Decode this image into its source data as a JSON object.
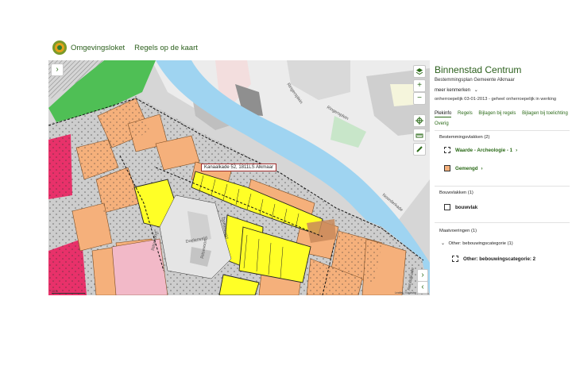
{
  "header": {
    "brand_name": "Omgevingsloket",
    "title": "Regels op de kaart"
  },
  "map": {
    "tooltip": "Kanaalkade 52, 1811LS Alkmaar",
    "scale_label": "10 m",
    "credit": "Leaflet | Kadaster | PDOK",
    "street_labels": [
      "Ringersplein",
      "Ringersplein",
      "Noorderkade",
      "Doelenveld",
      "Doelenveld",
      "Ritsevoort",
      "Ritsevoort",
      "Kanaalkade"
    ],
    "controls": {
      "collapse_left": "›",
      "layers": "layers-icon",
      "zoom_in": "+",
      "zoom_out": "−",
      "locate": "crosshair-icon",
      "measure": "ruler-icon",
      "draw": "pencil-icon",
      "panel_toggle": "›",
      "panel_toggle2": "‹"
    },
    "colors": {
      "water": "#9fd4f1",
      "gemengd": "#f5b07b",
      "wonen": "#ffff26",
      "groen": "#4fbf55",
      "bedrijf": "#e8316a",
      "verkeer": "#cdcdcd"
    }
  },
  "panel": {
    "title": "Binnenstad Centrum",
    "subtitle": "Bestemmingsplan  Gemeente Alkmaar",
    "more": "meer kenmerken",
    "status": "onherroepelijk 03-01-2013 - geheel onherroepelijk in werking",
    "tabs": [
      "Plekinfo",
      "Regels",
      "Bijlagen bij regels",
      "Bijlagen bij toelichting",
      "Overig"
    ],
    "sections": {
      "bestemmingsvlakken": {
        "heading": "Bestemmingsvlakken (2)",
        "items": [
          {
            "label": "Waarde - Archeologie - 1",
            "chevron": "›",
            "color": "#ffffff"
          },
          {
            "label": "Gemengd",
            "chevron": "›",
            "color": "#f5b07b"
          }
        ]
      },
      "bouwvlakken": {
        "heading": "Bouwvlakken (1)",
        "items": [
          {
            "label": "bouwvlak",
            "color": "#ffffff"
          }
        ]
      },
      "maatvoeringen": {
        "heading": "Maatvoeringen (1)",
        "group": "Other: bebouwingscategorie (1)",
        "items": [
          {
            "label": "Other: bebouwingscategorie: 2"
          }
        ]
      }
    }
  }
}
